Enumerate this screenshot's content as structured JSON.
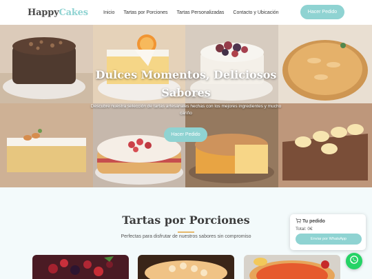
{
  "header": {
    "logo_part1": "Happy",
    "logo_part2": "Cakes",
    "nav": [
      "Inicio",
      "Tartas por Porciones",
      "Tartas Personalizadas",
      "Contacto y Ubicación"
    ],
    "cta": "Hacer Pedido"
  },
  "hero": {
    "title": "Dulces Momentos, Deliciosos Sabores",
    "subtitle": "Descubre nuestra selección de tartas artesanales hechas con los mejores ingredientes y mucho cariño",
    "cta": "Hacer Pedido"
  },
  "section": {
    "title": "Tartas por Porciones",
    "subtitle": "Perfectas para disfrutar de nuestros sabores sin compromiso"
  },
  "cart": {
    "icon": "cart-icon",
    "title": "Tu pedido",
    "total": "Total: 0€",
    "button": "Enviar por WhatsApp"
  },
  "whatsapp": {
    "icon": "whatsapp-icon"
  },
  "colors": {
    "accent": "#8fd3d2",
    "gold": "#e6b86a",
    "whatsapp": "#25d366"
  }
}
